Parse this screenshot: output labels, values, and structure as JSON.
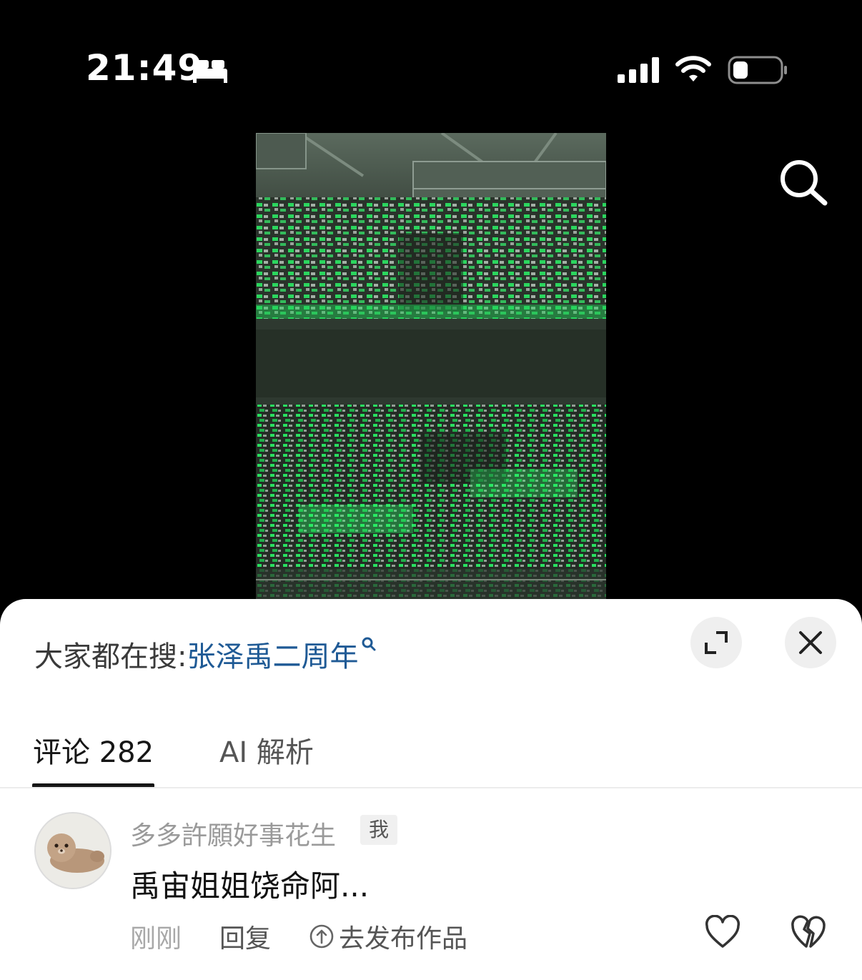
{
  "status_bar": {
    "time": "21:49",
    "icons": [
      "sleep-icon",
      "cellular-signal-icon",
      "wifi-icon",
      "battery-icon"
    ]
  },
  "video": {
    "icons": [
      "search-icon"
    ]
  },
  "sheet": {
    "trending_label": "大家都在搜:",
    "trending_query": "张泽禹二周年",
    "icons": [
      "expand-icon",
      "close-icon"
    ]
  },
  "tabs": {
    "comments_label": "评论 282",
    "ai_label": "AI 解析"
  },
  "comment": {
    "username": "多多許願好事花生",
    "badge": "我",
    "text": "禹宙姐姐饶命阿...",
    "time": "刚刚",
    "reply_label": "回复",
    "publish_label": "去发布作品",
    "icons": [
      "avatar",
      "upload-circle-icon",
      "like-heart-icon",
      "dislike-heart-icon"
    ]
  },
  "colors": {
    "link": "#1f5a95",
    "background": "#000000",
    "sheet": "#ffffff",
    "glow": "#2cff6a"
  }
}
